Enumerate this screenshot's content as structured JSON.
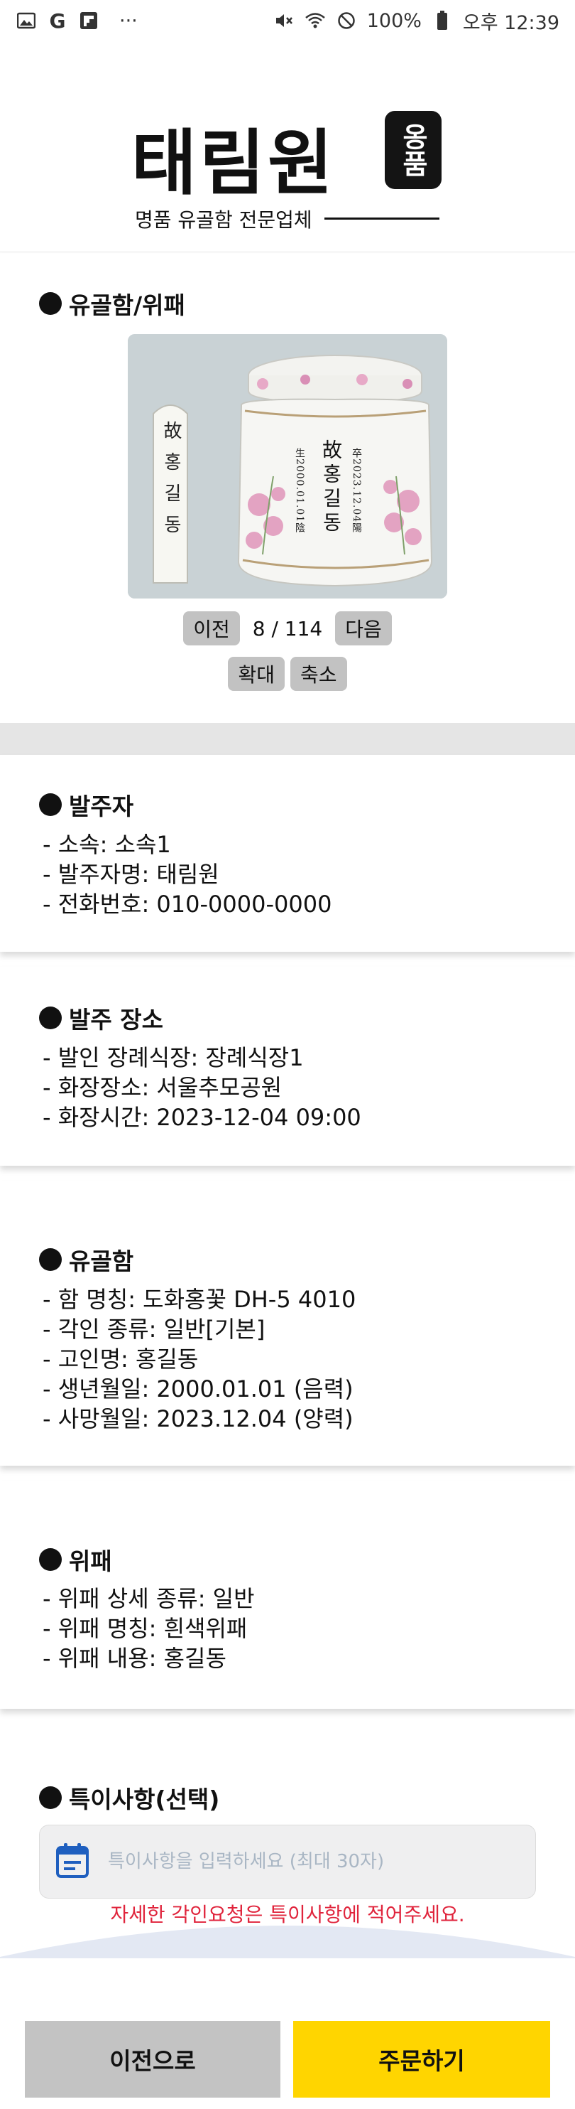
{
  "status_bar": {
    "left_icons": [
      "gallery-icon",
      "google-icon",
      "flipboard-icon"
    ],
    "more": "···",
    "battery": "100%",
    "time": "오후 12:39"
  },
  "brand": {
    "logo_text": "태림원",
    "seal_text": "옹품",
    "tagline": "명품 유골함 전문업체"
  },
  "product": {
    "title": "유골함/위패",
    "tablet_text": "故홍길동",
    "urn_name": "故홍길동",
    "urn_birth": "生2000.01.01陰",
    "urn_death": "卒2023.12.04陽",
    "prev_label": "이전",
    "page_count": "8 / 114",
    "next_label": "다음",
    "zoom_in_label": "확대",
    "zoom_out_label": "축소"
  },
  "orderer": {
    "title": "발주자",
    "lines": [
      "- 소속: 소속1",
      "- 발주자명: 태림원",
      "- 전화번호: 010-0000-0000"
    ]
  },
  "place": {
    "title": "발주 장소",
    "lines": [
      "- 발인 장례식장: 장례식장1",
      "- 화장장소: 서울추모공원",
      "- 화장시간: 2023-12-04 09:00"
    ]
  },
  "urn": {
    "title": "유골함",
    "lines": [
      "- 함 명칭: 도화홍꽃 DH-5 4010",
      "- 각인 종류: 일반[기본]",
      "- 고인명: 홍길동",
      "- 생년월일: 2000.01.01 (음력)",
      "- 사망월일: 2023.12.04 (양력)"
    ]
  },
  "tablet": {
    "title": "위패",
    "lines": [
      "- 위패 상세 종류: 일반",
      "- 위패 명칭: 흰색위패",
      "- 위패 내용: 홍길동"
    ]
  },
  "memo": {
    "title": "특이사항(선택)",
    "placeholder": "특이사항을 입력하세요 (최대 30자)",
    "hint": "자세한 각인요청은 특이사항에 적어주세요."
  },
  "actions": {
    "prev_label": "이전으로",
    "order_label": "주문하기"
  },
  "colors": {
    "order_button": "#ffd500",
    "prev_button": "#c3c3c3",
    "hint_text": "#e0243c",
    "memo_icon": "#1f5fbf"
  }
}
